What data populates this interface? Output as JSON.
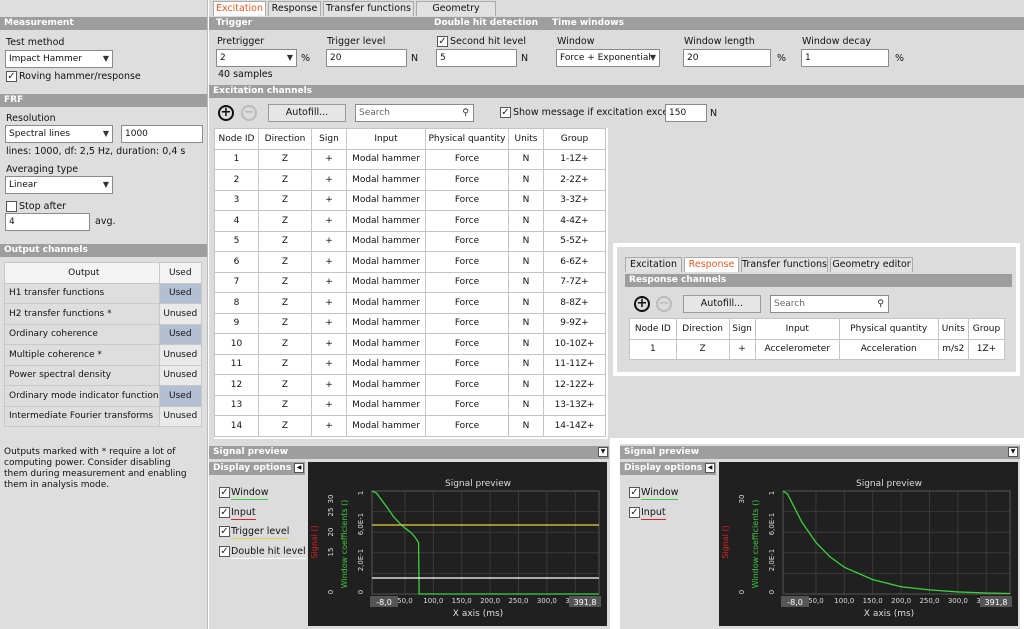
{
  "tabs": [
    "Excitation",
    "Response",
    "Transfer functions",
    "Geometry editor"
  ],
  "measurement": {
    "header": "Measurement",
    "test_method_label": "Test method",
    "test_method": "Impact Hammer",
    "roving_label": "Roving hammer/response",
    "roving_checked": true
  },
  "frf": {
    "header": "FRF",
    "resolution_label": "Resolution",
    "resolution": "Spectral lines",
    "resolution_value": "1000",
    "info": "lines: 1000, df: 2,5 Hz, duration: 0,4 s",
    "averaging_label": "Averaging type",
    "averaging": "Linear",
    "stop_after_label": "Stop after",
    "stop_after_value": "4",
    "avg_label": "avg."
  },
  "output": {
    "header": "Output channels",
    "col_output": "Output",
    "col_used": "Used",
    "rows": [
      {
        "name": "H1 transfer functions",
        "used": "Used"
      },
      {
        "name": "H2 transfer functions *",
        "used": "Unused"
      },
      {
        "name": "Ordinary coherence",
        "used": "Used"
      },
      {
        "name": "Multiple coherence *",
        "used": "Unused"
      },
      {
        "name": "Power spectral density",
        "used": "Unused"
      },
      {
        "name": "Ordinary mode indicator function",
        "used": "Used"
      },
      {
        "name": "Intermediate Fourier transforms",
        "used": "Unused"
      }
    ],
    "note": "Outputs marked with * require a lot of computing power. Consider disabling them during measurement and enabling them in analysis mode."
  },
  "trigger": {
    "header": "Trigger",
    "pretrigger_label": "Pretrigger",
    "pretrigger": "2",
    "pct": "%",
    "samples": "40 samples",
    "level_label": "Trigger level",
    "level": "20",
    "unit_n": "N"
  },
  "double_hit": {
    "header": "Double hit detection",
    "second_label": "Second hit level",
    "second_checked": true,
    "value": "5",
    "unit": "N"
  },
  "time_windows": {
    "header": "Time windows",
    "window_label": "Window",
    "window": "Force + Exponential",
    "length_label": "Window length",
    "length": "20",
    "decay_label": "Window decay",
    "decay": "1",
    "pct": "%"
  },
  "excitation": {
    "header": "Excitation channels",
    "autofill": "Autofill...",
    "search_placeholder": "Search",
    "show_msg_label": "Show message if excitation exceeds",
    "show_msg_checked": true,
    "threshold": "150",
    "unit": "N",
    "columns": [
      "Node ID",
      "Direction",
      "Sign",
      "Input",
      "Physical quantity",
      "Units",
      "Group"
    ],
    "rows": [
      [
        "1",
        "Z",
        "+",
        "Modal hammer",
        "Force",
        "N",
        "1-1Z+"
      ],
      [
        "2",
        "Z",
        "+",
        "Modal hammer",
        "Force",
        "N",
        "2-2Z+"
      ],
      [
        "3",
        "Z",
        "+",
        "Modal hammer",
        "Force",
        "N",
        "3-3Z+"
      ],
      [
        "4",
        "Z",
        "+",
        "Modal hammer",
        "Force",
        "N",
        "4-4Z+"
      ],
      [
        "5",
        "Z",
        "+",
        "Modal hammer",
        "Force",
        "N",
        "5-5Z+"
      ],
      [
        "6",
        "Z",
        "+",
        "Modal hammer",
        "Force",
        "N",
        "6-6Z+"
      ],
      [
        "7",
        "Z",
        "+",
        "Modal hammer",
        "Force",
        "N",
        "7-7Z+"
      ],
      [
        "8",
        "Z",
        "+",
        "Modal hammer",
        "Force",
        "N",
        "8-8Z+"
      ],
      [
        "9",
        "Z",
        "+",
        "Modal hammer",
        "Force",
        "N",
        "9-9Z+"
      ],
      [
        "10",
        "Z",
        "+",
        "Modal hammer",
        "Force",
        "N",
        "10-10Z+"
      ],
      [
        "11",
        "Z",
        "+",
        "Modal hammer",
        "Force",
        "N",
        "11-11Z+"
      ],
      [
        "12",
        "Z",
        "+",
        "Modal hammer",
        "Force",
        "N",
        "12-12Z+"
      ],
      [
        "13",
        "Z",
        "+",
        "Modal hammer",
        "Force",
        "N",
        "13-13Z+"
      ],
      [
        "14",
        "Z",
        "+",
        "Modal hammer",
        "Force",
        "N",
        "14-14Z+"
      ]
    ]
  },
  "response_panel": {
    "tabs": [
      "Excitation",
      "Response",
      "Transfer functions",
      "Geometry editor"
    ],
    "header": "Response channels",
    "autofill": "Autofill...",
    "search_placeholder": "Search",
    "columns": [
      "Node ID",
      "Direction",
      "Sign",
      "Input",
      "Physical quantity",
      "Units",
      "Group"
    ],
    "rows": [
      [
        "1",
        "Z",
        "+",
        "Accelerometer",
        "Acceleration",
        "m/s2",
        "1Z+"
      ]
    ]
  },
  "preview_left": {
    "header": "Signal preview",
    "display_options": "Display options",
    "options": [
      {
        "label": "Window",
        "checked": true,
        "color": "#3cc83c"
      },
      {
        "label": "Input",
        "checked": true,
        "color": "#e02020"
      },
      {
        "label": "Trigger level",
        "checked": true,
        "color": "#e6d23c"
      },
      {
        "label": "Double hit level",
        "checked": true,
        "color": "#ffffff"
      }
    ],
    "title": "Signal preview",
    "xlabel": "X axis (ms)",
    "ylabel_signal": "Signal ()",
    "ylabel_window": "Window coefficients ()",
    "x_min_label": "-8,0",
    "x_max_label": "391,8",
    "x_ticks": [
      "50,0",
      "100,0",
      "150,0",
      "200,0",
      "250,0",
      "300,0",
      "350,0"
    ],
    "y_top": "30",
    "y_ticks": [
      "25",
      "20",
      "15"
    ],
    "y_zero": "0",
    "w_top": "1",
    "w_mid1": "6,0E-1",
    "w_mid2": "2,0E-1",
    "w_zero": "0"
  },
  "preview_right": {
    "header": "Signal preview",
    "display_options": "Display options",
    "options": [
      {
        "label": "Window",
        "checked": true,
        "color": "#3cc83c"
      },
      {
        "label": "Input",
        "checked": true,
        "color": "#e02020"
      }
    ],
    "title": "Signal preview",
    "xlabel": "X axis (ms)",
    "ylabel_signal": "Signal ()",
    "ylabel_window": "Window coefficients ()",
    "x_min_label": "-8,0",
    "x_max_label": "391,8",
    "x_ticks": [
      "50,0",
      "100,0",
      "150,0",
      "200,0",
      "250,0",
      "300,0",
      "350,0"
    ],
    "y_top": "30",
    "y_zero": "0",
    "w_top": "1",
    "w_mid1": "6,0E-1",
    "w_mid2": "2,0E-1",
    "w_zero": "0"
  },
  "chart_data": [
    {
      "type": "line",
      "title": "Signal preview",
      "xlabel": "X axis (ms)",
      "ylabel": "Window coefficients ()",
      "xlim": [
        -8.0,
        391.8
      ],
      "ylim": [
        0,
        1
      ],
      "series": [
        {
          "name": "Window",
          "x": [
            -8,
            0,
            20,
            30,
            40,
            50,
            60,
            68,
            74,
            75,
            76,
            391.8
          ],
          "values": [
            1,
            0.98,
            0.83,
            0.75,
            0.69,
            0.64,
            0.6,
            0.55,
            0.5,
            0.0,
            0.0,
            0.0
          ]
        },
        {
          "name": "Trigger level",
          "x": [
            -8,
            391.8
          ],
          "values": [
            20,
            20
          ]
        },
        {
          "name": "Double hit level",
          "x": [
            -8,
            391.8
          ],
          "values": [
            5,
            5
          ]
        }
      ]
    },
    {
      "type": "line",
      "title": "Signal preview",
      "xlabel": "X axis (ms)",
      "ylabel": "Window coefficients ()",
      "xlim": [
        -8.0,
        391.8
      ],
      "ylim": [
        0,
        1
      ],
      "series": [
        {
          "name": "Window",
          "x": [
            -8,
            0,
            25,
            50,
            75,
            100,
            150,
            200,
            250,
            300,
            350,
            391.8
          ],
          "values": [
            1,
            0.97,
            0.7,
            0.5,
            0.36,
            0.26,
            0.14,
            0.07,
            0.04,
            0.02,
            0.01,
            0.005
          ]
        }
      ]
    }
  ]
}
